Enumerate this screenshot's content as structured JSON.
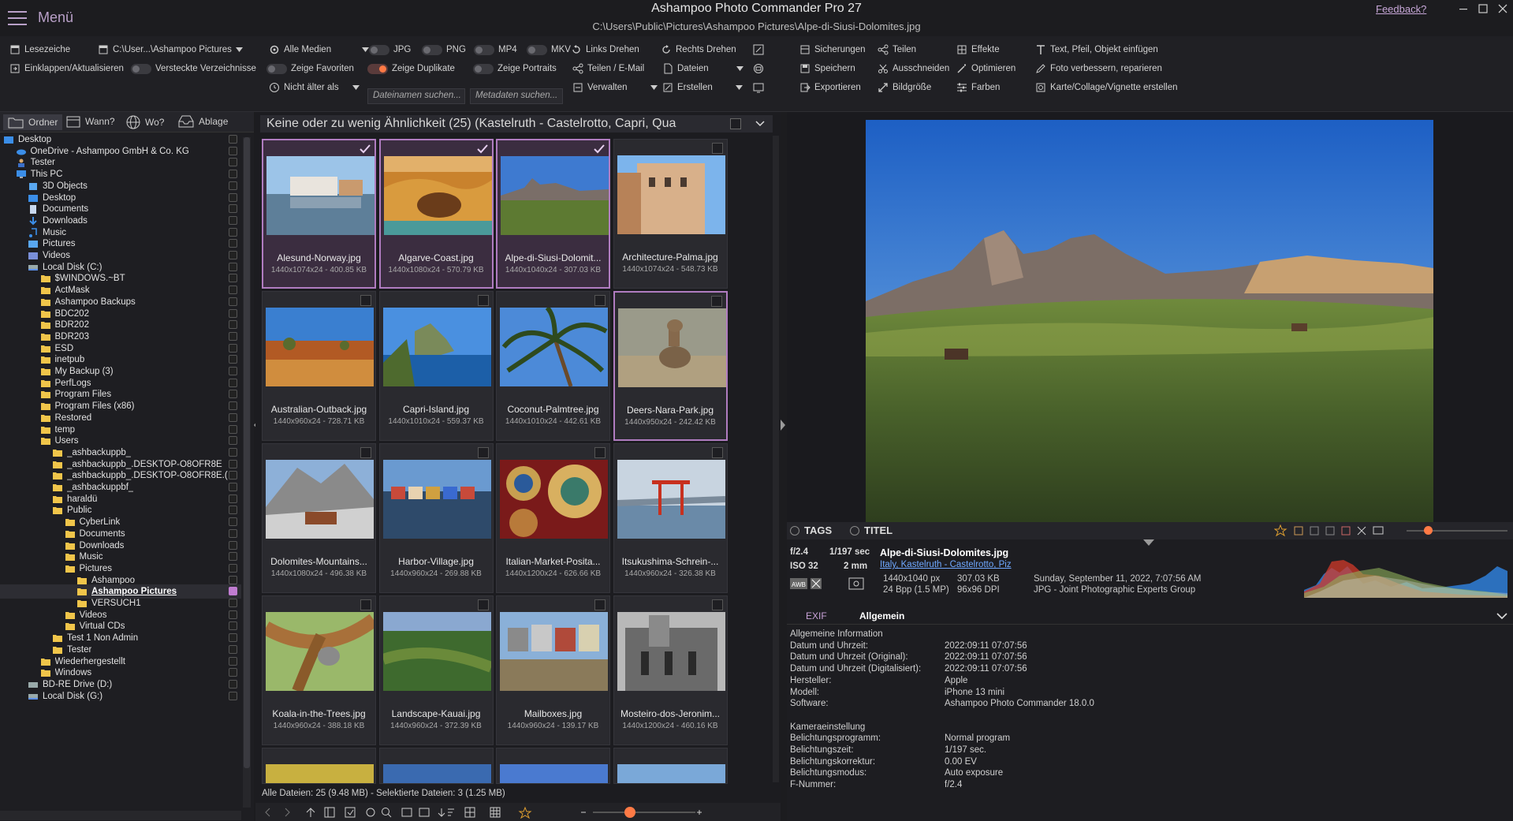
{
  "app": {
    "menu_label": "Menü",
    "title": "Ashampoo Photo Commander Pro 27",
    "path": "C:\\Users\\Public\\Pictures\\Ashampoo Pictures\\Alpe-di-Siusi-Dolomites.jpg",
    "feedback": "Feedback?"
  },
  "toolbar": {
    "bookmarks": "Lesezeichen",
    "path_combo": "C:\\User...\\Ashampoo Pictures",
    "collapse_refresh": "Einklappen/Aktualisieren",
    "hidden_dirs": "Versteckte Verzeichnisse",
    "all_media": "Alle Medien",
    "jpg": "JPG",
    "png": "PNG",
    "mp4": "MP4",
    "mkv": "MKV",
    "show_favorites": "Zeige Favoriten",
    "show_duplicates": "Zeige Duplikate",
    "show_portraits": "Zeige Portraits",
    "not_older": "Nicht älter als",
    "filename_search": "Dateinamen suchen...",
    "metadata_search": "Metadaten suchen...",
    "rotate_left": "Links Drehen",
    "rotate_right": "Rechts Drehen",
    "share_email": "Teilen / E-Mail",
    "files": "Dateien",
    "manage": "Verwalten",
    "create": "Erstellen",
    "backups": "Sicherungen",
    "save": "Speichern",
    "export": "Exportieren",
    "share": "Teilen",
    "cut": "Ausschneiden",
    "image_size": "Bildgröße",
    "effects": "Effekte",
    "optimize": "Optimieren",
    "colors": "Farben",
    "insert_text": "Text, Pfeil, Objekt einfügen",
    "improve_photo": "Foto verbessern, reparieren",
    "card_collage": "Karte/Collage/Vignette erstellen"
  },
  "left_tabs": [
    "Ordner",
    "Wann?",
    "Wo?",
    "Ablage"
  ],
  "tree": [
    {
      "label": "Desktop",
      "icon": "folder-blue-icon",
      "indent": 0
    },
    {
      "label": "OneDrive - Ashampoo GmbH & Co. KG",
      "icon": "cloud-icon",
      "indent": 1
    },
    {
      "label": "Tester",
      "icon": "user-icon",
      "indent": 1
    },
    {
      "label": "This PC",
      "icon": "monitor-icon",
      "indent": 1
    },
    {
      "label": "3D Objects",
      "icon": "cube-icon",
      "indent": 2
    },
    {
      "label": "Desktop",
      "icon": "folder-blue-icon",
      "indent": 2
    },
    {
      "label": "Documents",
      "icon": "document-icon",
      "indent": 2
    },
    {
      "label": "Downloads",
      "icon": "download-icon",
      "indent": 2
    },
    {
      "label": "Music",
      "icon": "music-icon",
      "indent": 2
    },
    {
      "label": "Pictures",
      "icon": "picture-icon",
      "indent": 2
    },
    {
      "label": "Videos",
      "icon": "video-icon",
      "indent": 2
    },
    {
      "label": "Local Disk (C:)",
      "icon": "drive-icon",
      "indent": 2
    },
    {
      "label": "$WINDOWS.~BT",
      "icon": "folder-icon",
      "indent": 3
    },
    {
      "label": "ActMask",
      "icon": "folder-icon",
      "indent": 3
    },
    {
      "label": "Ashampoo Backups",
      "icon": "folder-icon",
      "indent": 3
    },
    {
      "label": "BDC202",
      "icon": "folder-icon",
      "indent": 3
    },
    {
      "label": "BDR202",
      "icon": "folder-icon",
      "indent": 3
    },
    {
      "label": "BDR203",
      "icon": "folder-icon",
      "indent": 3
    },
    {
      "label": "ESD",
      "icon": "folder-icon",
      "indent": 3
    },
    {
      "label": "inetpub",
      "icon": "folder-icon",
      "indent": 3
    },
    {
      "label": "My Backup (3)",
      "icon": "folder-icon",
      "indent": 3
    },
    {
      "label": "PerfLogs",
      "icon": "folder-icon",
      "indent": 3
    },
    {
      "label": "Program Files",
      "icon": "folder-icon",
      "indent": 3
    },
    {
      "label": "Program Files (x86)",
      "icon": "folder-icon",
      "indent": 3
    },
    {
      "label": "Restored",
      "icon": "folder-icon",
      "indent": 3
    },
    {
      "label": "temp",
      "icon": "folder-icon",
      "indent": 3
    },
    {
      "label": "Users",
      "icon": "folder-icon",
      "indent": 3
    },
    {
      "label": "_ashbackuppb_",
      "icon": "folder-icon",
      "indent": 4
    },
    {
      "label": "_ashbackuppb_.DESKTOP-O8OFR8E",
      "icon": "folder-icon",
      "indent": 4
    },
    {
      "label": "_ashbackuppb_.DESKTOP-O8OFR8E.(",
      "icon": "folder-icon",
      "indent": 4
    },
    {
      "label": "_ashbackuppbf_",
      "icon": "folder-icon",
      "indent": 4
    },
    {
      "label": "haraldü",
      "icon": "folder-icon",
      "indent": 4
    },
    {
      "label": "Public",
      "icon": "folder-icon",
      "indent": 4
    },
    {
      "label": "CyberLink",
      "icon": "folder-icon",
      "indent": 5
    },
    {
      "label": "Documents",
      "icon": "folder-icon",
      "indent": 5
    },
    {
      "label": "Downloads",
      "icon": "folder-icon",
      "indent": 5
    },
    {
      "label": "Music",
      "icon": "folder-icon",
      "indent": 5
    },
    {
      "label": "Pictures",
      "icon": "folder-icon",
      "indent": 5
    },
    {
      "label": "Ashampoo",
      "icon": "folder-icon",
      "indent": 6
    },
    {
      "label": "Ashampoo Pictures",
      "icon": "folder-icon",
      "indent": 6,
      "selected": true
    },
    {
      "label": "VERSUCH1",
      "icon": "folder-icon",
      "indent": 6
    },
    {
      "label": "Videos",
      "icon": "folder-icon",
      "indent": 5
    },
    {
      "label": "Virtual CDs",
      "icon": "folder-icon",
      "indent": 5
    },
    {
      "label": "Test 1 Non Admin",
      "icon": "folder-icon",
      "indent": 4
    },
    {
      "label": "Tester",
      "icon": "folder-icon",
      "indent": 4
    },
    {
      "label": "Wiederhergestellt",
      "icon": "folder-icon",
      "indent": 3
    },
    {
      "label": "Windows",
      "icon": "folder-icon",
      "indent": 3
    },
    {
      "label": "BD-RE Drive (D:)",
      "icon": "disc-icon",
      "indent": 2
    },
    {
      "label": "Local Disk (G:)",
      "icon": "drive-icon",
      "indent": 2
    }
  ],
  "group_header": "Keine oder zu wenig Ähnlichkeit  (25)  (Kastelruth - Castelrotto, Capri, Qua",
  "thumbnails": [
    {
      "name": "Alesund-Norway.jpg",
      "info": "1440x1074x24 - 400.85 KB",
      "selected": true,
      "scene": "harbor"
    },
    {
      "name": "Algarve-Coast.jpg",
      "info": "1440x1080x24 - 570.79 KB",
      "selected": true,
      "scene": "coast"
    },
    {
      "name": "Alpe-di-Siusi-Dolomit...",
      "info": "1440x1040x24 - 307.03 KB",
      "selected": true,
      "scene": "meadow"
    },
    {
      "name": "Architecture-Palma.jpg",
      "info": "1440x1074x24 - 548.73 KB",
      "scene": "building"
    },
    {
      "name": "Australian-Outback.jpg",
      "info": "1440x960x24 - 728.71 KB",
      "scene": "outback"
    },
    {
      "name": "Capri-Island.jpg",
      "info": "1440x1010x24 - 559.37 KB",
      "scene": "island"
    },
    {
      "name": "Coconut-Palmtree.jpg",
      "info": "1440x1010x24 - 442.61 KB",
      "scene": "palm"
    },
    {
      "name": "Deers-Nara-Park.jpg",
      "info": "1440x950x24 - 242.42 KB",
      "focused": true,
      "scene": "deer"
    },
    {
      "name": "Dolomites-Mountains...",
      "info": "1440x1080x24 - 496.38 KB",
      "scene": "mountain"
    },
    {
      "name": "Harbor-Village.jpg",
      "info": "1440x960x24 - 269.88 KB",
      "scene": "village"
    },
    {
      "name": "Italian-Market-Posita...",
      "info": "1440x1200x24 - 626.66 KB",
      "scene": "market"
    },
    {
      "name": "Itsukushima-Schrein-...",
      "info": "1440x960x24 - 326.38 KB",
      "scene": "shrine"
    },
    {
      "name": "Koala-in-the-Trees.jpg",
      "info": "1440x960x24 - 388.18 KB",
      "scene": "koala"
    },
    {
      "name": "Landscape-Kauai.jpg",
      "info": "1440x960x24 - 372.39 KB",
      "scene": "kauai"
    },
    {
      "name": "Mailboxes.jpg",
      "info": "1440x960x24 - 139.17 KB",
      "scene": "mailbox"
    },
    {
      "name": "Mosteiro-dos-Jeronim...",
      "info": "1440x1200x24 - 460.16 KB",
      "scene": "monastery"
    }
  ],
  "status": "Alle Dateien: 25 (9.48 MB) - Selektierte Dateien: 3 (1.25 MB)",
  "preview": {
    "tags": "TAGS",
    "title": "TITEL",
    "aperture": "f/2.4",
    "shutter": "1/197 sec",
    "iso": "ISO 32",
    "focal": "2 mm",
    "filename": "Alpe-di-Siusi-Dolomites.jpg",
    "location": "Italy, Kastelruth - Castelrotto, Piz",
    "dimensions": "1440x1040 px",
    "megapixel": "24 Bpp (1.5 MP)",
    "size": "307.03 KB",
    "dpi": "96x96 DPI",
    "date": "Sunday, September 11, 2022, 7:07:56 AM",
    "format": "JPG - Joint Photographic Experts Group"
  },
  "exif_tabs": [
    "EXIF",
    "Allgemein"
  ],
  "exif": [
    {
      "k": "Allgemeine Information",
      "v": ""
    },
    {
      "k": "Datum und Uhrzeit:",
      "v": "2022:09:11 07:07:56"
    },
    {
      "k": "Datum und Uhrzeit (Original):",
      "v": "2022:09:11 07:07:56"
    },
    {
      "k": "Datum und Uhrzeit (Digitalisiert):",
      "v": "2022:09:11 07:07:56"
    },
    {
      "k": "Hersteller:",
      "v": "Apple"
    },
    {
      "k": "Modell:",
      "v": "iPhone 13 mini"
    },
    {
      "k": "Software:",
      "v": "Ashampoo Photo Commander 18.0.0"
    },
    {
      "k": "",
      "v": ""
    },
    {
      "k": "Kameraeinstellung",
      "v": ""
    },
    {
      "k": "Belichtungsprogramm:",
      "v": "Normal program"
    },
    {
      "k": "Belichtungszeit:",
      "v": "1/197 sec."
    },
    {
      "k": "Belichtungskorrektur:",
      "v": "0.00 EV"
    },
    {
      "k": "Belichtungsmodus:",
      "v": "Auto exposure"
    },
    {
      "k": "F-Nummer:",
      "v": "f/2.4"
    }
  ],
  "colors": {
    "accent": "#c07cd0",
    "orange": "#ff7a45",
    "link": "#6fa8ff"
  }
}
